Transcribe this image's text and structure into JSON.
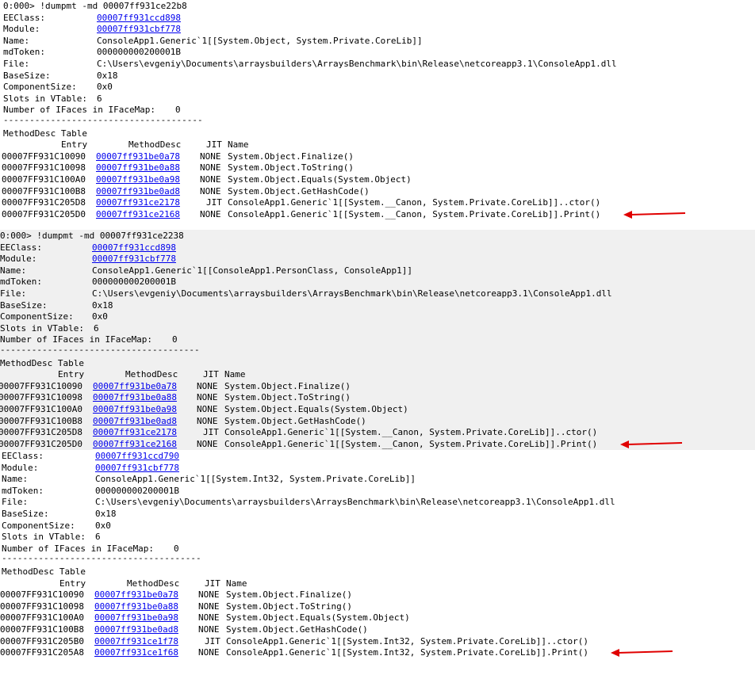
{
  "colors": {
    "link": "#0000ee",
    "arrow": "#e00000",
    "gray_panel": "#f0f0f0"
  },
  "blocks": [
    {
      "command": "0:000> !dumpmt -md 00007ff931ce22b8",
      "fields": [
        {
          "label": "EEClass:",
          "value": "00007ff931ccd898",
          "link": true
        },
        {
          "label": "Module:",
          "value": "00007ff931cbf778",
          "link": true
        },
        {
          "label": "Name:",
          "value": "ConsoleApp1.Generic`1[[System.Object, System.Private.CoreLib]]",
          "link": false
        },
        {
          "label": "mdToken:",
          "value": "000000000200001B",
          "link": false
        },
        {
          "label": "File:",
          "value": "C:\\Users\\evgeniy\\Documents\\arraysbuilders\\ArraysBenchmark\\bin\\Release\\netcoreapp3.1\\ConsoleApp1.dll",
          "link": false
        },
        {
          "label": "BaseSize:",
          "value": "0x18",
          "link": false
        },
        {
          "label": "ComponentSize:",
          "value": "0x0",
          "link": false
        },
        {
          "label": "Slots in VTable:",
          "value": "6",
          "link": false
        },
        {
          "label": "Number of IFaces in IFaceMap:",
          "value": "0",
          "link": false
        }
      ],
      "separator": "--------------------------------------",
      "table_title": "MethodDesc Table",
      "headers": {
        "entry": "Entry",
        "md": "MethodDesc",
        "jit": "JIT",
        "name": "Name"
      },
      "rows": [
        {
          "entry": "00007FF931C10090",
          "md": "00007ff931be0a78",
          "jit": "NONE",
          "name": "System.Object.Finalize()"
        },
        {
          "entry": "00007FF931C10098",
          "md": "00007ff931be0a88",
          "jit": "NONE",
          "name": "System.Object.ToString()"
        },
        {
          "entry": "00007FF931C100A0",
          "md": "00007ff931be0a98",
          "jit": "NONE",
          "name": "System.Object.Equals(System.Object)"
        },
        {
          "entry": "00007FF931C100B8",
          "md": "00007ff931be0ad8",
          "jit": "NONE",
          "name": "System.Object.GetHashCode()"
        },
        {
          "entry": "00007FF931C205D8",
          "md": "00007ff931ce2178",
          "jit": "JIT",
          "name": "ConsoleApp1.Generic`1[[System.__Canon, System.Private.CoreLib]]..ctor()"
        },
        {
          "entry": "00007FF931C205D0",
          "md": "00007ff931ce2168",
          "jit": "NONE",
          "name": "ConsoleApp1.Generic`1[[System.__Canon, System.Private.CoreLib]].Print()"
        }
      ]
    },
    {
      "command": "0:000> !dumpmt -md 00007ff931ce2238",
      "fields": [
        {
          "label": "EEClass:",
          "value": "00007ff931ccd898",
          "link": true
        },
        {
          "label": "Module:",
          "value": "00007ff931cbf778",
          "link": true
        },
        {
          "label": "Name:",
          "value": "ConsoleApp1.Generic`1[[ConsoleApp1.PersonClass, ConsoleApp1]]",
          "link": false
        },
        {
          "label": "mdToken:",
          "value": "000000000200001B",
          "link": false
        },
        {
          "label": "File:",
          "value": "C:\\Users\\evgeniy\\Documents\\arraysbuilders\\ArraysBenchmark\\bin\\Release\\netcoreapp3.1\\ConsoleApp1.dll",
          "link": false
        },
        {
          "label": "BaseSize:",
          "value": "0x18",
          "link": false
        },
        {
          "label": "ComponentSize:",
          "value": "0x0",
          "link": false
        },
        {
          "label": "Slots in VTable:",
          "value": "6",
          "link": false
        },
        {
          "label": "Number of IFaces in IFaceMap:",
          "value": "0",
          "link": false
        }
      ],
      "separator": "--------------------------------------",
      "table_title": "MethodDesc Table",
      "headers": {
        "entry": "Entry",
        "md": "MethodDesc",
        "jit": "JIT",
        "name": "Name"
      },
      "rows": [
        {
          "entry": "00007FF931C10090",
          "md": "00007ff931be0a78",
          "jit": "NONE",
          "name": "System.Object.Finalize()"
        },
        {
          "entry": "00007FF931C10098",
          "md": "00007ff931be0a88",
          "jit": "NONE",
          "name": "System.Object.ToString()"
        },
        {
          "entry": "00007FF931C100A0",
          "md": "00007ff931be0a98",
          "jit": "NONE",
          "name": "System.Object.Equals(System.Object)"
        },
        {
          "entry": "00007FF931C100B8",
          "md": "00007ff931be0ad8",
          "jit": "NONE",
          "name": "System.Object.GetHashCode()"
        },
        {
          "entry": "00007FF931C205D8",
          "md": "00007ff931ce2178",
          "jit": "JIT",
          "name": "ConsoleApp1.Generic`1[[System.__Canon, System.Private.CoreLib]]..ctor()"
        },
        {
          "entry": "00007FF931C205D0",
          "md": "00007ff931ce2168",
          "jit": "NONE",
          "name": "ConsoleApp1.Generic`1[[System.__Canon, System.Private.CoreLib]].Print()"
        }
      ]
    },
    {
      "command": "",
      "fields": [
        {
          "label": "EEClass:",
          "value": "00007ff931ccd790",
          "link": true
        },
        {
          "label": "Module:",
          "value": "00007ff931cbf778",
          "link": true
        },
        {
          "label": "Name:",
          "value": "ConsoleApp1.Generic`1[[System.Int32, System.Private.CoreLib]]",
          "link": false
        },
        {
          "label": "mdToken:",
          "value": "000000000200001B",
          "link": false
        },
        {
          "label": "File:",
          "value": "C:\\Users\\evgeniy\\Documents\\arraysbuilders\\ArraysBenchmark\\bin\\Release\\netcoreapp3.1\\ConsoleApp1.dll",
          "link": false
        },
        {
          "label": "BaseSize:",
          "value": "0x18",
          "link": false
        },
        {
          "label": "ComponentSize:",
          "value": "0x0",
          "link": false
        },
        {
          "label": "Slots in VTable:",
          "value": "6",
          "link": false
        },
        {
          "label": "Number of IFaces in IFaceMap:",
          "value": "0",
          "link": false
        }
      ],
      "separator": "--------------------------------------",
      "table_title": "MethodDesc Table",
      "headers": {
        "entry": "Entry",
        "md": "MethodDesc",
        "jit": "JIT",
        "name": "Name"
      },
      "rows": [
        {
          "entry": "00007FF931C10090",
          "md": "00007ff931be0a78",
          "jit": "NONE",
          "name": "System.Object.Finalize()"
        },
        {
          "entry": "00007FF931C10098",
          "md": "00007ff931be0a88",
          "jit": "NONE",
          "name": "System.Object.ToString()"
        },
        {
          "entry": "00007FF931C100A0",
          "md": "00007ff931be0a98",
          "jit": "NONE",
          "name": "System.Object.Equals(System.Object)"
        },
        {
          "entry": "00007FF931C100B8",
          "md": "00007ff931be0ad8",
          "jit": "NONE",
          "name": "System.Object.GetHashCode()"
        },
        {
          "entry": "00007FF931C205B0",
          "md": "00007ff931ce1f78",
          "jit": "JIT",
          "name": "ConsoleApp1.Generic`1[[System.Int32, System.Private.CoreLib]]..ctor()"
        },
        {
          "entry": "00007FF931C205A8",
          "md": "00007ff931ce1f68",
          "jit": "NONE",
          "name": "ConsoleApp1.Generic`1[[System.Int32, System.Private.CoreLib]].Print()"
        }
      ]
    }
  ]
}
